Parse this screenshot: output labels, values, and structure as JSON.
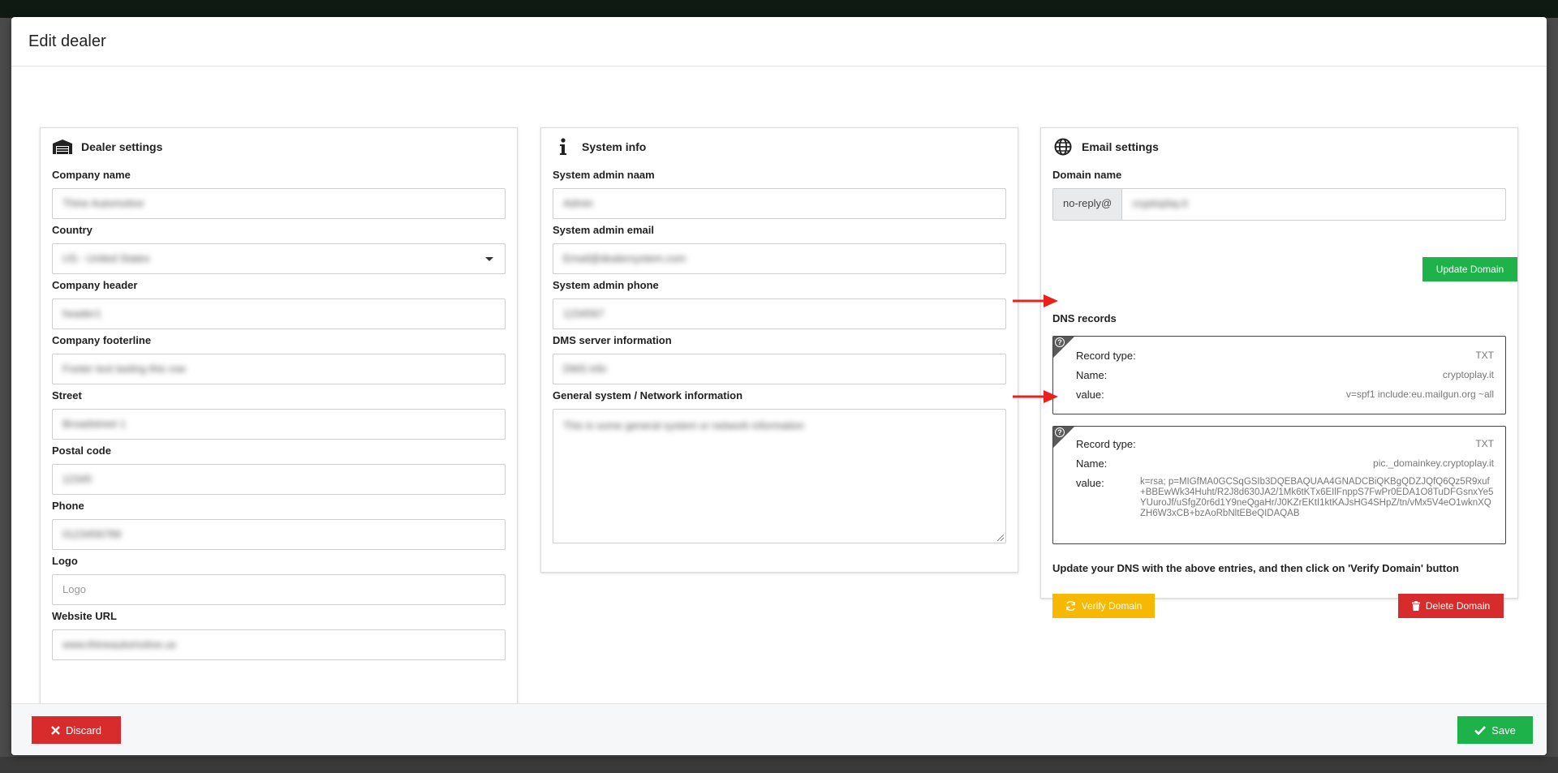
{
  "modal": {
    "title": "Edit dealer"
  },
  "dealer_settings": {
    "title": "Dealer settings",
    "icon": "warehouse-icon",
    "fields": [
      {
        "label": "Company name",
        "value": "Thine Automotive"
      },
      {
        "label": "Country",
        "value": "US - United States"
      },
      {
        "label": "Company header",
        "value": "header1"
      },
      {
        "label": "Company footerline",
        "value": "Footer text lasting this row"
      },
      {
        "label": "Street",
        "value": "Broadstreet 1"
      },
      {
        "label": "Postal code",
        "value": "12345"
      },
      {
        "label": "Phone",
        "value": "0123456789"
      },
      {
        "label": "Logo",
        "placeholder": "Logo"
      },
      {
        "label": "Website URL",
        "value": "www.thineautomotive.us"
      }
    ]
  },
  "system_info": {
    "title": "System info",
    "icon": "info-icon",
    "fields": [
      {
        "label": "System admin naam",
        "value": "Admin"
      },
      {
        "label": "System admin email",
        "value": "Email@dealersystem.com"
      },
      {
        "label": "System admin phone",
        "value": "1234567"
      },
      {
        "label": "DMS server information",
        "value": "DMS info"
      },
      {
        "label": "General system / Network information",
        "value": "This is some general system or network information"
      }
    ]
  },
  "email_settings": {
    "title": "Email settings",
    "icon": "globe-icon",
    "domain_label": "Domain name",
    "domain_prefix": "no-reply@",
    "domain_value": "cryptoplay.it",
    "update_button": "Update Domain",
    "dns_heading": "DNS records",
    "records": [
      {
        "type_label": "Record type:",
        "type": "TXT",
        "name_label": "Name:",
        "name": "cryptoplay.it",
        "value_label": "value:",
        "value": "v=spf1 include:eu.mailgun.org ~all"
      },
      {
        "type_label": "Record type:",
        "type": "TXT",
        "name_label": "Name:",
        "name": "pic._domainkey.cryptoplay.it",
        "value_label": "value:",
        "value": "k=rsa; p=MIGfMA0GCSqGSIb3DQEBAQUAA4GNADCBiQKBgQDZJQfQ6Qz5R9xuf+BBEwWk34Huht/R2J8d630JA2/1Mk6tKTx6EIlFnppS7FwPr0EDA1O8TuDFGsnxYe5YUuroJf/uSfgZ0r6d1Y9neQgaHr/J0KZrEKtI1ktKAJsHG4SHpZ/tn/vMx5V4eO1wknXQZH6W3xCB+bzAoRbNltEBeQIDAQAB"
      }
    ],
    "notice": "Update your DNS with the above entries, and then click on 'Verify Domain' button",
    "verify_button": "Verify Domain",
    "delete_button": "Delete Domain"
  },
  "footer": {
    "discard": "Discard",
    "save": "Save"
  },
  "colors": {
    "green": "#1db34a",
    "red": "#d82c2c",
    "yellow": "#f6b800",
    "arrow": "#e8211b"
  }
}
